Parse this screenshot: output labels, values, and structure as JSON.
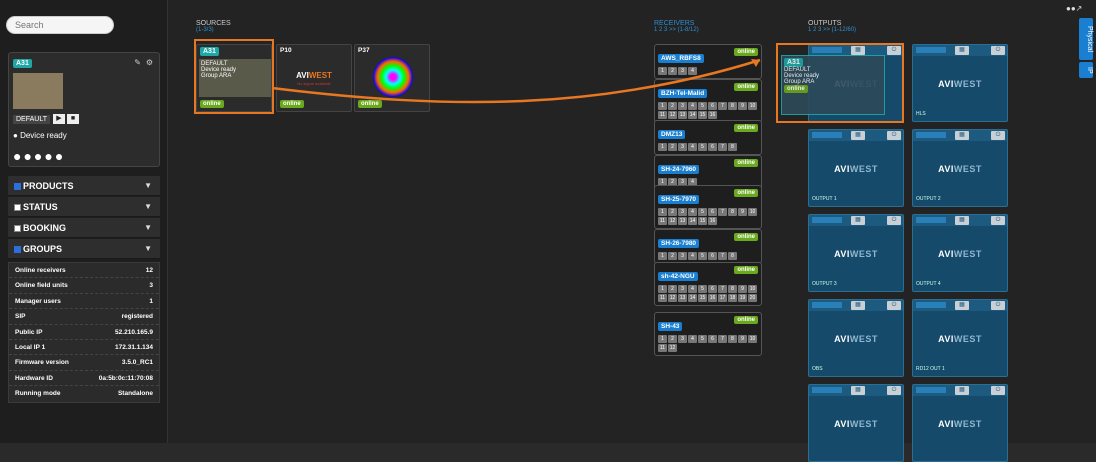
{
  "search": {
    "placeholder": "Search"
  },
  "unit": {
    "tag": "A31",
    "profile": "DEFAULT",
    "status": "Device ready"
  },
  "sections": [
    {
      "label": "PRODUCTS",
      "checked": true
    },
    {
      "label": "STATUS",
      "checked": false
    },
    {
      "label": "BOOKING",
      "checked": false
    },
    {
      "label": "GROUPS",
      "checked": true
    }
  ],
  "stats": [
    [
      "Online receivers",
      "12"
    ],
    [
      "Online field units",
      "3"
    ],
    [
      "Manager users",
      "1"
    ],
    [
      "SIP",
      "registered"
    ],
    [
      "Public IP",
      "52.210.165.9"
    ],
    [
      "Local IP 1",
      "172.31.1.134"
    ],
    [
      "Firmware version",
      "3.5.0_RC1"
    ],
    [
      "Hardware ID",
      "0a:5b:0c:11:70:08"
    ],
    [
      "Running mode",
      "Standalone"
    ]
  ],
  "sources": {
    "title": "SOURCES",
    "sub": "(1-3/3)",
    "cards": [
      {
        "name": "A31",
        "line1": "DEFAULT",
        "line2": "Device ready",
        "line3": "Group ARA",
        "status": "online"
      },
      {
        "name": "P10",
        "note": "No signal available",
        "status": "online"
      },
      {
        "name": "P37",
        "status": "online"
      }
    ]
  },
  "receivers": {
    "title": "RECEIVERS",
    "sub": "1 2 3 >> (1-8/12)",
    "items": [
      {
        "name": "AWS_RBFS8",
        "status": "online",
        "chips": [
          "1",
          "2",
          "3",
          "4"
        ]
      },
      {
        "name": "BZH-Tel-Malid",
        "status": "online",
        "chips": [
          "1",
          "2",
          "3",
          "4",
          "5",
          "6",
          "7",
          "8",
          "9",
          "10",
          "11",
          "12",
          "13",
          "14",
          "15",
          "16"
        ]
      },
      {
        "name": "DMZ13",
        "status": "online",
        "chips": [
          "1",
          "2",
          "3",
          "4",
          "5",
          "6",
          "7",
          "8"
        ]
      },
      {
        "name": "SH-24-7960",
        "status": "online",
        "chips": [
          "1",
          "2",
          "3",
          "4"
        ]
      },
      {
        "name": "SH-25-7970",
        "status": "online",
        "chips": [
          "1",
          "2",
          "3",
          "4",
          "5",
          "6",
          "7",
          "8",
          "9",
          "10",
          "11",
          "12",
          "13",
          "14",
          "15",
          "16"
        ]
      },
      {
        "name": "SH-26-7980",
        "status": "online",
        "chips": [
          "1",
          "2",
          "3",
          "4",
          "5",
          "6",
          "7",
          "8"
        ]
      },
      {
        "name": "sh-42-NGU",
        "status": "online",
        "chips": [
          "1",
          "2",
          "3",
          "4",
          "5",
          "6",
          "7",
          "8",
          "9",
          "10",
          "11",
          "12",
          "13",
          "14",
          "15",
          "16",
          "17",
          "18",
          "19",
          "20"
        ]
      },
      {
        "name": "SH-43",
        "status": "online",
        "chips": [
          "1",
          "2",
          "3",
          "4",
          "5",
          "6",
          "7",
          "8",
          "9",
          "10",
          "11",
          "12"
        ]
      }
    ]
  },
  "outputs": {
    "title": "OUTPUTS",
    "sub": "1 2 3 >> (1-12/60)",
    "cards": [
      {
        "label": "",
        "name": "A31",
        "l1": "DEFAULT",
        "l2": "Device ready",
        "l3": "Group ARA",
        "status": "online"
      },
      {
        "label": "HLS"
      },
      {
        "label": "OUTPUT 1"
      },
      {
        "label": "OUTPUT 2"
      },
      {
        "label": "OUTPUT 3"
      },
      {
        "label": "OUTPUT 4"
      },
      {
        "label": "OBS"
      },
      {
        "label": "RD12 OUT 1"
      },
      {
        "label": ""
      },
      {
        "label": ""
      }
    ]
  },
  "logo": {
    "a": "AVI",
    "w": "WEST"
  },
  "sidetabs": {
    "physical": "Physical",
    "ip": "IP"
  }
}
